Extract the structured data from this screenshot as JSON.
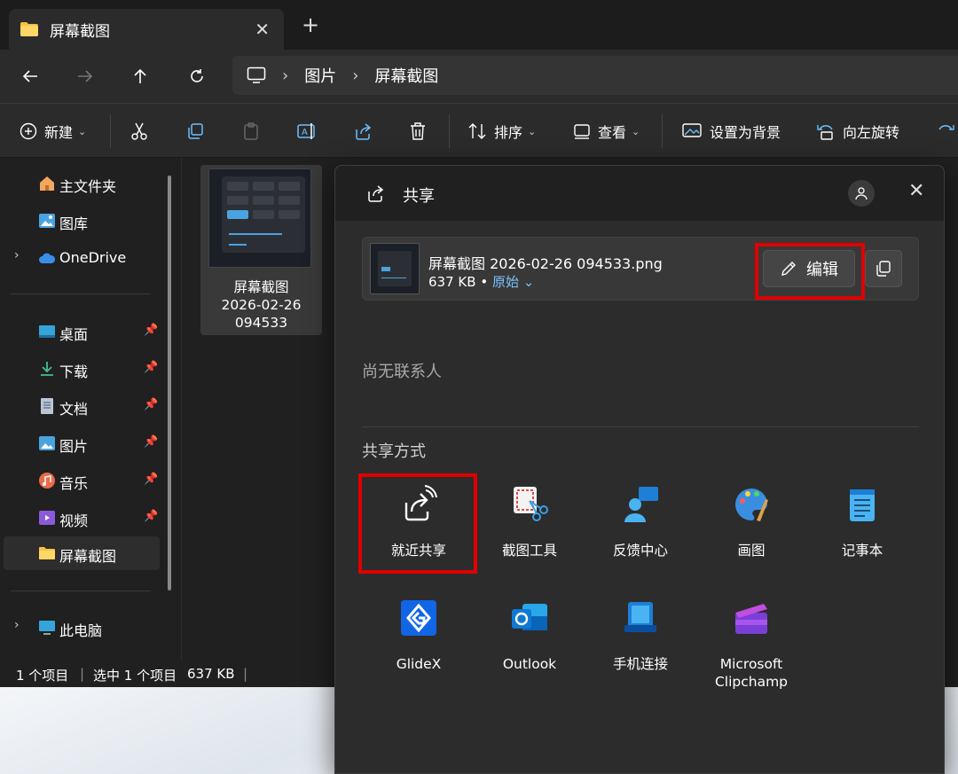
{
  "tab": {
    "title": "屏幕截图",
    "close": "✕",
    "new": "+"
  },
  "breadcrumb": {
    "items": [
      "图片",
      "屏幕截图"
    ]
  },
  "commands": {
    "new": "新建",
    "sort": "排序",
    "view": "查看",
    "set_background": "设置为背景",
    "rotate_left": "向左旋转"
  },
  "sidebar": {
    "items": [
      {
        "label": "主文件夹"
      },
      {
        "label": "图库"
      },
      {
        "label": "OneDrive"
      },
      {
        "label": "桌面"
      },
      {
        "label": "下载"
      },
      {
        "label": "文档"
      },
      {
        "label": "图片"
      },
      {
        "label": "音乐"
      },
      {
        "label": "视频"
      },
      {
        "label": "屏幕截图"
      },
      {
        "label": "此电脑"
      }
    ]
  },
  "file": {
    "name_line1": "屏幕截图",
    "name_line2": "2026-02-26",
    "name_line3": "094533"
  },
  "status": {
    "count": "1 个项目",
    "selected": "选中 1 个项目",
    "size": "637 KB"
  },
  "share": {
    "title": "共享",
    "file_name": "屏幕截图 2026-02-26 094533.png",
    "file_size": "637 KB",
    "bullet": "•",
    "original": "原始",
    "edit": "编辑",
    "no_contacts": "尚无联系人",
    "share_via": "共享方式",
    "apps": [
      {
        "label": "就近共享"
      },
      {
        "label": "截图工具"
      },
      {
        "label": "反馈中心"
      },
      {
        "label": "画图"
      },
      {
        "label": "记事本"
      },
      {
        "label": "GlideX"
      },
      {
        "label": "Outlook"
      },
      {
        "label": "手机连接"
      },
      {
        "label_line1": "Microsoft",
        "label_line2": "Clipchamp"
      }
    ]
  },
  "colors": {
    "accent": "#4aa3df",
    "highlight": "#e00000",
    "link": "#7cc3ff"
  }
}
